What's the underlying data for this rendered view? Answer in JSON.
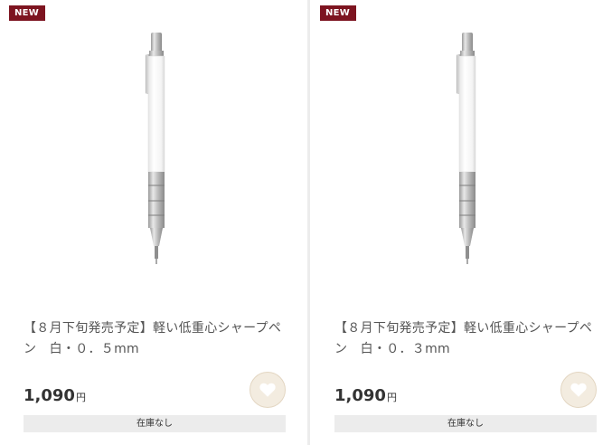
{
  "products": [
    {
      "badge": "NEW",
      "image_alt": "white mechanical pencil",
      "title": "【８月下旬発売予定】軽い低重心シャープペン　白・０．５mm",
      "price": "1,090",
      "currency": "円",
      "favorite_icon": "heart-icon",
      "stock": "在庫なし"
    },
    {
      "badge": "NEW",
      "image_alt": "white mechanical pencil",
      "title": "【８月下旬発売予定】軽い低重心シャープペン　白・０．３mm",
      "price": "1,090",
      "currency": "円",
      "favorite_icon": "heart-icon",
      "stock": "在庫なし"
    }
  ],
  "colors": {
    "badge_bg": "#7d1420",
    "favorite_bg": "#f3ece0",
    "stock_bg": "#ececec"
  }
}
